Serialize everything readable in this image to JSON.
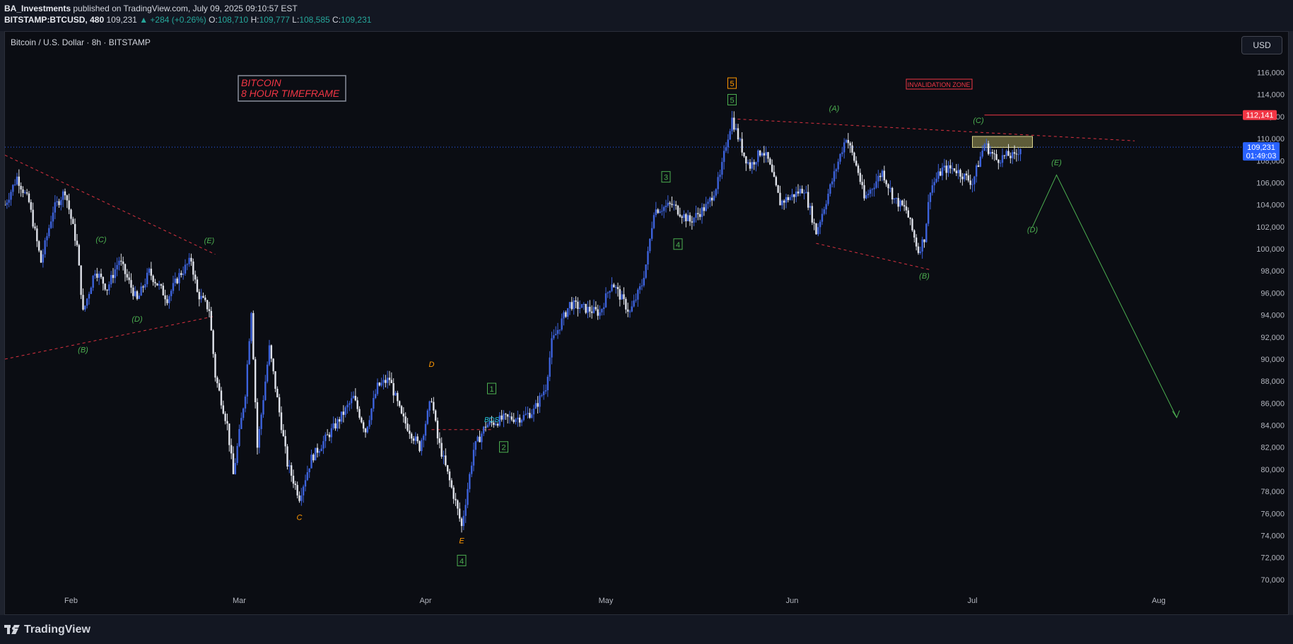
{
  "header": {
    "author": "BA_Investments",
    "published_text": "published on TradingView.com, July 09, 2025 09:10:57 EST",
    "symbol": "BITSTAMP:BTCUSD, 480",
    "last": "109,231",
    "change": "▲ +284 (+0.26%)",
    "o_label": "O:",
    "o_value": "108,710",
    "h_label": "H:",
    "h_value": "109,777",
    "l_label": "L:",
    "l_value": "108,585",
    "c_label": "C:",
    "c_value": "109,231"
  },
  "chart_title": "Bitcoin / U.S. Dollar · 8h · BITSTAMP",
  "currency_button": "USD",
  "footer": {
    "brand": "TradingView"
  },
  "colors": {
    "background": "#0b0d13",
    "candle_up": "#3d63dd",
    "candle_down": "#e0e3eb",
    "wave_green": "#4caf50",
    "wave_orange": "#ff9800",
    "trend_red": "#f23645",
    "price_label": "#2962ff"
  },
  "chart_data": {
    "type": "candlestick",
    "x_ticks": [
      "Feb",
      "Mar",
      "Apr",
      "May",
      "Jun",
      "Jul",
      "Aug"
    ],
    "y_ticks": [
      "116,000",
      "114,000",
      "112,000",
      "110,000",
      "108,000",
      "106,000",
      "104,000",
      "102,000",
      "100,000",
      "98,000",
      "96,000",
      "94,000",
      "92,000",
      "90,000",
      "88,000",
      "86,000",
      "84,000",
      "82,000",
      "80,000",
      "78,000",
      "76,000",
      "74,000",
      "72,000",
      "70,000"
    ],
    "ylim": [
      69800,
      117700
    ],
    "xlim": [
      "2025-01-21",
      "2025-08-09"
    ],
    "last_price_label": "109,231",
    "countdown_label": "01:49:03",
    "invalidation_price_label": "112,141",
    "invalidation_label": "INVALIDATION ZONE",
    "title_box": [
      "BITCOIN",
      "8 HOUR TIMEFRAME"
    ],
    "bos_label": "BOS",
    "price_path": [
      [
        "2025-01-21",
        104000
      ],
      [
        "2025-01-23",
        106500
      ],
      [
        "2025-01-25",
        104200
      ],
      [
        "2025-01-27",
        98800
      ],
      [
        "2025-01-29",
        103500
      ],
      [
        "2025-01-31",
        105300
      ],
      [
        "2025-02-02",
        100200
      ],
      [
        "2025-02-03",
        94200
      ],
      [
        "2025-02-05",
        98100
      ],
      [
        "2025-02-07",
        96400
      ],
      [
        "2025-02-09",
        99000
      ],
      [
        "2025-02-12",
        95300
      ],
      [
        "2025-02-14",
        97900
      ],
      [
        "2025-02-17",
        95500
      ],
      [
        "2025-02-19",
        97600
      ],
      [
        "2025-02-21",
        99000
      ],
      [
        "2025-02-22",
        96000
      ],
      [
        "2025-02-24",
        94500
      ],
      [
        "2025-02-25",
        88500
      ],
      [
        "2025-02-27",
        84000
      ],
      [
        "2025-02-28",
        79500
      ],
      [
        "2025-03-02",
        87000
      ],
      [
        "2025-03-03",
        94500
      ],
      [
        "2025-03-04",
        82000
      ],
      [
        "2025-03-06",
        91000
      ],
      [
        "2025-03-09",
        80500
      ],
      [
        "2025-03-11",
        77500
      ],
      [
        "2025-03-13",
        81000
      ],
      [
        "2025-03-17",
        84000
      ],
      [
        "2025-03-20",
        86500
      ],
      [
        "2025-03-22",
        83500
      ],
      [
        "2025-03-24",
        87500
      ],
      [
        "2025-03-26",
        88200
      ],
      [
        "2025-03-28",
        84800
      ],
      [
        "2025-03-31",
        82000
      ],
      [
        "2025-04-02",
        86500
      ],
      [
        "2025-04-03",
        82800
      ],
      [
        "2025-04-06",
        77000
      ],
      [
        "2025-04-07",
        74800
      ],
      [
        "2025-04-09",
        81800
      ],
      [
        "2025-04-11",
        84000
      ],
      [
        "2025-04-14",
        84600
      ],
      [
        "2025-04-17",
        84700
      ],
      [
        "2025-04-19",
        85300
      ],
      [
        "2025-04-21",
        87500
      ],
      [
        "2025-04-22",
        91500
      ],
      [
        "2025-04-25",
        95000
      ],
      [
        "2025-04-28",
        94500
      ],
      [
        "2025-04-30",
        94200
      ],
      [
        "2025-05-02",
        97000
      ],
      [
        "2025-05-05",
        94200
      ],
      [
        "2025-05-07",
        96800
      ],
      [
        "2025-05-08",
        99500
      ],
      [
        "2025-05-09",
        103500
      ],
      [
        "2025-05-12",
        104000
      ],
      [
        "2025-05-14",
        103000
      ],
      [
        "2025-05-15",
        102500
      ],
      [
        "2025-05-18",
        104000
      ],
      [
        "2025-05-20",
        106500
      ],
      [
        "2025-05-21",
        109500
      ],
      [
        "2025-05-22",
        111800
      ],
      [
        "2025-05-24",
        108500
      ],
      [
        "2025-05-25",
        107500
      ],
      [
        "2025-05-27",
        109000
      ],
      [
        "2025-05-28",
        108000
      ],
      [
        "2025-05-30",
        104200
      ],
      [
        "2025-06-01",
        104800
      ],
      [
        "2025-06-03",
        105500
      ],
      [
        "2025-06-05",
        101500
      ],
      [
        "2025-06-07",
        105000
      ],
      [
        "2025-06-09",
        108500
      ],
      [
        "2025-06-10",
        110200
      ],
      [
        "2025-06-12",
        107000
      ],
      [
        "2025-06-13",
        104500
      ],
      [
        "2025-06-16",
        107000
      ],
      [
        "2025-06-18",
        104500
      ],
      [
        "2025-06-20",
        103500
      ],
      [
        "2025-06-22",
        99800
      ],
      [
        "2025-06-23",
        101000
      ],
      [
        "2025-06-24",
        105500
      ],
      [
        "2025-06-26",
        107200
      ],
      [
        "2025-06-28",
        107300
      ],
      [
        "2025-07-01",
        106000
      ],
      [
        "2025-07-03",
        109500
      ],
      [
        "2025-07-05",
        108100
      ],
      [
        "2025-07-07",
        108500
      ],
      [
        "2025-07-08",
        108300
      ],
      [
        "2025-07-09",
        109231
      ]
    ],
    "wave_labels": [
      {
        "text": "(C)",
        "date": "2025-02-06",
        "price": 100600,
        "color": "green"
      },
      {
        "text": "(E)",
        "date": "2025-02-24",
        "price": 100500,
        "color": "green"
      },
      {
        "text": "(D)",
        "date": "2025-02-12",
        "price": 93400,
        "color": "green"
      },
      {
        "text": "(B)",
        "date": "2025-02-03",
        "price": 90600,
        "color": "green"
      },
      {
        "text": "C",
        "date": "2025-03-11",
        "price": 75400,
        "color": "orange"
      },
      {
        "text": "D",
        "date": "2025-04-02",
        "price": 89300,
        "color": "orange"
      },
      {
        "text": "E",
        "date": "2025-04-07",
        "price": 73300,
        "color": "orange"
      },
      {
        "text": "(A)",
        "date": "2025-06-08",
        "price": 112500,
        "color": "green"
      },
      {
        "text": "(C)",
        "date": "2025-07-02",
        "price": 111400,
        "color": "green"
      },
      {
        "text": "(B)",
        "date": "2025-06-23",
        "price": 97300,
        "color": "green"
      },
      {
        "text": "(E)",
        "date": "2025-07-15",
        "price": 107600,
        "color": "green"
      },
      {
        "text": "(D)",
        "date": "2025-07-11",
        "price": 101500,
        "color": "green"
      }
    ],
    "wave_boxes": [
      {
        "text": "5",
        "date": "2025-05-22",
        "price": 115000,
        "color": "orange"
      },
      {
        "text": "5",
        "date": "2025-05-22",
        "price": 113500,
        "color": "green"
      },
      {
        "text": "3",
        "date": "2025-05-11",
        "price": 106500,
        "color": "green"
      },
      {
        "text": "4",
        "date": "2025-05-13",
        "price": 100400,
        "color": "green"
      },
      {
        "text": "1",
        "date": "2025-04-12",
        "price": 87300,
        "color": "green"
      },
      {
        "text": "2",
        "date": "2025-04-14",
        "price": 82000,
        "color": "green"
      },
      {
        "text": "4",
        "date": "2025-04-07",
        "price": 71700,
        "color": "green"
      }
    ],
    "trend_lines": [
      {
        "from": [
          "2025-01-21",
          108500
        ],
        "to": [
          "2025-02-25",
          99500
        ]
      },
      {
        "from": [
          "2025-01-21",
          90000
        ],
        "to": [
          "2025-02-25",
          93900
        ]
      },
      {
        "from": [
          "2025-05-22",
          111800
        ],
        "to": [
          "2025-07-28",
          109800
        ]
      },
      {
        "from": [
          "2025-06-05",
          100500
        ],
        "to": [
          "2025-06-24",
          98100
        ]
      },
      {
        "from": [
          "2025-04-02",
          83600
        ],
        "to": [
          "2025-04-12",
          83600
        ]
      }
    ],
    "projection_path": [
      [
        "2025-07-11",
        102000
      ],
      [
        "2025-07-15",
        106700
      ],
      [
        "2025-08-04",
        84700
      ]
    ],
    "resistance_box": {
      "from": [
        "2025-07-01",
        110200
      ],
      "to": [
        "2025-07-11",
        109200
      ]
    }
  }
}
